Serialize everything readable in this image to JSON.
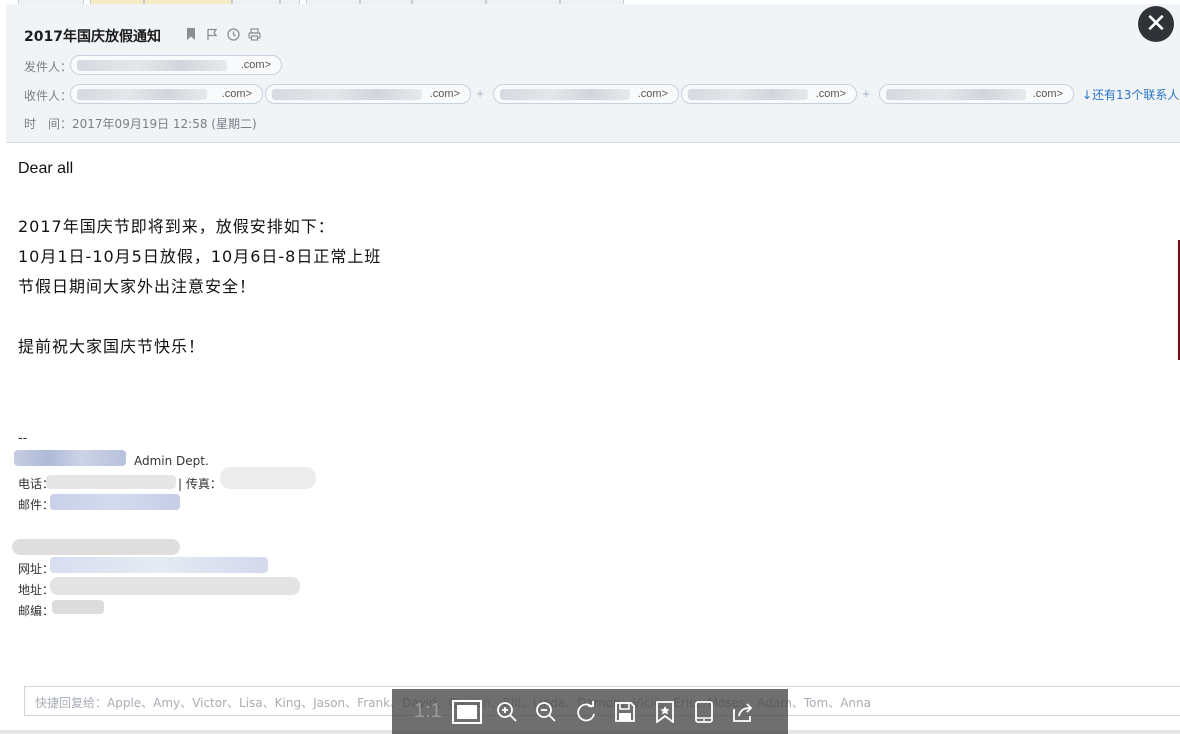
{
  "email": {
    "subject": "2017年国庆放假通知",
    "from_label": "发件人：",
    "from_suffix": ".com>",
    "to_label": "收件人：",
    "to_suffixes": [
      ".com>",
      ".com>",
      ".com>",
      ".com>",
      ".com>"
    ],
    "more_recipients": "↓还有13个联系人",
    "time_label": "时　间：",
    "time_value": "2017年09月19日 12:58 (星期二)"
  },
  "body": {
    "greeting": "Dear all",
    "lines": [
      "2017年国庆节即将到来，放假安排如下：",
      "10月1日-10月5日放假，10月6日-8日正常上班",
      "节假日期间大家外出注意安全！",
      "提前祝大家国庆节快乐！"
    ],
    "sig_dash": "--",
    "dept": "Admin Dept.",
    "phone_label": "电话：",
    "fax_label": "| 传真：",
    "mail_label": "邮件：",
    "web_label": "网址：",
    "addr_label": "地址：",
    "zip_label": "邮编："
  },
  "reply": {
    "placeholder": "快捷回复给：Apple、Amy、Victor、Lisa、King、Jason、Frank、David、Carson、Bill、Linda、Damon、Vicie、Eric、Moses、Adam、Tom、Anna"
  },
  "viewer": {
    "ratio_label": "1:1",
    "icons": [
      "fit-screen-icon",
      "zoom-in-icon",
      "zoom-out-icon",
      "rotate-icon",
      "save-icon",
      "bookmark-icon",
      "device-icon",
      "share-icon"
    ]
  },
  "colors": {
    "header_bg": "#f1f4f7",
    "link": "#2a74c5",
    "close_bg": "#2f3237"
  }
}
